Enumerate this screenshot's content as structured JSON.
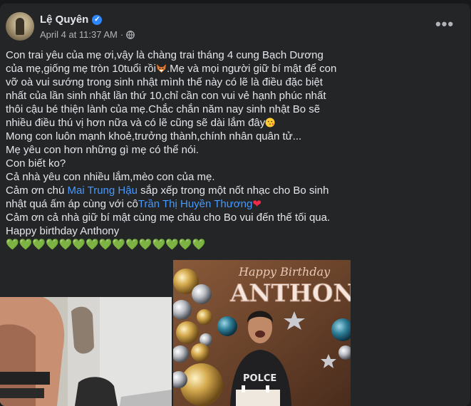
{
  "post": {
    "author": "Lệ Quyên",
    "verified_icon": "verified-badge-icon",
    "timestamp": "April 4 at 11:37 AM",
    "separator": "·",
    "audience_icon": "globe-icon",
    "more_label": "•••",
    "lines": {
      "l1": "Con trai yêu của mẹ ơi,vậy là chàng trai tháng 4 cung Bạch Dương của mẹ,giống mẹ tròn 10tuổi rồi",
      "l1b": ".Mẹ và mọi người giữ bí mật để con vỡ oà vui sướng trong sinh nhật mình thế này có lẽ là điều đặc biệt nhất của lần sinh nhật lần thứ 10,chỉ cần con vui vẻ hạnh phúc nhất thôi cậu bé thiện lành của mẹ.Chắc chắn năm nay sinh nhật Bo sẽ nhiều điều thú vị hơn nữa và có lẽ cũng sẽ dài lắm đây",
      "l2": "Mong con luôn mạnh khoẻ,trưởng thành,chính nhân quân tử...",
      "l3": "Mẹ yêu con hơn những gì mẹ có thể nói.",
      "l4": "Con biết ko?",
      "l5": "Cả nhà yêu con nhiều lắm,mèo con của mẹ.",
      "l6a": "Cảm ơn chú ",
      "l6_link1": "Mai Trung Hậu",
      "l6b": " sắp xếp trong một nốt nhạc cho Bo sinh nhật quá ấm áp cùng với cô",
      "l6_link2": "Trần Thị Huyền Thương",
      "l6_heart": "❤",
      "l7": "Cảm ơn cả nhà giữ bí mật cùng mẹ cháu cho Bo vui đến thế tối qua.",
      "l8": "Happy birthday Anthony",
      "hearts": "💚💚💚💚💚💚💚💚💚💚💚💚💚💚💚"
    },
    "photo_right_banner": "ANTHONY",
    "photo_right_banner_top": "Happy Birthday",
    "shirt_text": "POLCE"
  },
  "colors": {
    "link": "#4599ff",
    "card": "#242526",
    "text": "#e4e6eb",
    "meta": "#b0b3b8",
    "green_heart": "#44c23a"
  }
}
